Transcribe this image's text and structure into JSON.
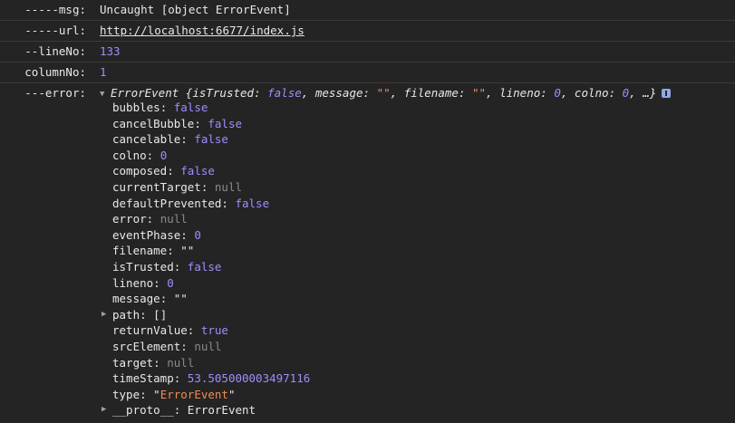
{
  "rows": [
    {
      "label": "-----msg:",
      "value": "Uncaught [object ErrorEvent]",
      "kind": "plain"
    },
    {
      "label": "-----url:",
      "value": "http://localhost:6677/index.js",
      "kind": "link"
    },
    {
      "label": "--lineNo:",
      "value": "133",
      "kind": "num"
    },
    {
      "label": "columnNo:",
      "value": "1",
      "kind": "num"
    }
  ],
  "error": {
    "label": "---error:",
    "summary": {
      "class": "ErrorEvent",
      "open": "{",
      "p1k": "isTrusted",
      "p1v": "false",
      "p2k": "message",
      "p2v": "\"\"",
      "p3k": "filename",
      "p3v": "\"\"",
      "p4k": "lineno",
      "p4v": "0",
      "p5k": "colno",
      "p5v": "0",
      "ellipsis": "…}"
    },
    "props": [
      {
        "key": "bubbles",
        "value": "false",
        "kind": "bool"
      },
      {
        "key": "cancelBubble",
        "value": "false",
        "kind": "bool"
      },
      {
        "key": "cancelable",
        "value": "false",
        "kind": "bool"
      },
      {
        "key": "colno",
        "value": "0",
        "kind": "num"
      },
      {
        "key": "composed",
        "value": "false",
        "kind": "bool"
      },
      {
        "key": "currentTarget",
        "value": "null",
        "kind": "null"
      },
      {
        "key": "defaultPrevented",
        "value": "false",
        "kind": "bool"
      },
      {
        "key": "error",
        "value": "null",
        "kind": "null"
      },
      {
        "key": "eventPhase",
        "value": "0",
        "kind": "num"
      },
      {
        "key": "filename",
        "value": "\"\"",
        "kind": "plain"
      },
      {
        "key": "isTrusted",
        "value": "false",
        "kind": "bool"
      },
      {
        "key": "lineno",
        "value": "0",
        "kind": "num"
      },
      {
        "key": "message",
        "value": "\"\"",
        "kind": "plain"
      },
      {
        "key": "path",
        "value": "[]",
        "kind": "plain",
        "expandable": true
      },
      {
        "key": "returnValue",
        "value": "true",
        "kind": "bool"
      },
      {
        "key": "srcElement",
        "value": "null",
        "kind": "null"
      },
      {
        "key": "target",
        "value": "null",
        "kind": "null"
      },
      {
        "key": "timeStamp",
        "value": "53.505000003497116",
        "kind": "num"
      },
      {
        "key": "type",
        "value": "ErrorEvent",
        "kind": "str"
      },
      {
        "key": "__proto__",
        "value": "ErrorEvent",
        "kind": "plain",
        "expandable": true
      }
    ]
  }
}
